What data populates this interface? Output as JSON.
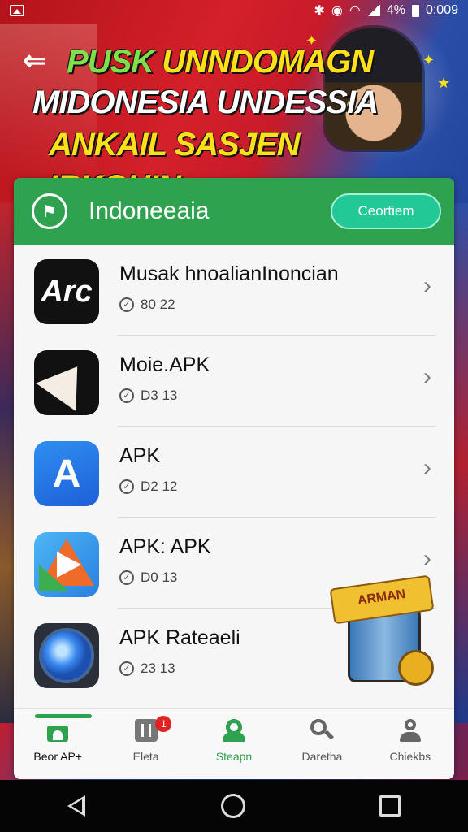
{
  "status_bar": {
    "battery": "4%",
    "time": "0:009",
    "icons": [
      "image-icon",
      "bluetooth-icon",
      "nfc-icon",
      "wifi-icon",
      "signal-icon",
      "battery-icon"
    ]
  },
  "banner": {
    "line1_green": "PUSK",
    "line1_yellow": "UNNDOMAGN",
    "line2": "MIDONESIA UNDESSIA",
    "line3": "ANKAIL SASJEN IRKOHIN"
  },
  "card": {
    "header_title": "Indoneeaia",
    "header_button": "Ceortiem",
    "colors": {
      "header_bg": "#2fa24f",
      "button_bg": "#22c997"
    }
  },
  "apps": [
    {
      "title": "Musak hnoalianInoncian",
      "meta": "80 22",
      "icon": "apk-logo-icon",
      "icon_text": "Arc"
    },
    {
      "title": "Moie.APK",
      "meta": "D3 13",
      "icon": "pen-nib-icon"
    },
    {
      "title": "APK",
      "meta": "D2 12",
      "icon": "a-letter-icon",
      "icon_text": "A"
    },
    {
      "title": "APK: APK",
      "meta": "D0 13",
      "icon": "paper-plane-icon"
    },
    {
      "title": "APK Rateaeli",
      "meta": "23 13",
      "icon": "orb-icon"
    }
  ],
  "mascot_text": "ARMAN",
  "tabs": [
    {
      "label": "Beor AP+",
      "icon": "home-icon",
      "active": false
    },
    {
      "label": "Eleta",
      "icon": "box-icon",
      "badge": "1"
    },
    {
      "label": "Steapn",
      "icon": "people-icon",
      "active": true
    },
    {
      "label": "Daretha",
      "icon": "search-icon"
    },
    {
      "label": "Chiekbs",
      "icon": "user-icon"
    }
  ]
}
